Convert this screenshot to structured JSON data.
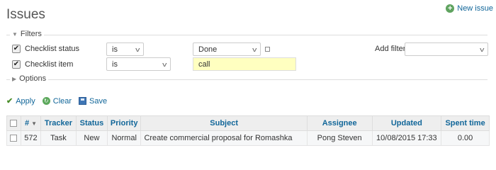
{
  "page": {
    "title": "Issues",
    "new_issue_label": "New issue"
  },
  "filters": {
    "legend": "Filters",
    "rows": [
      {
        "label": "Checklist status",
        "checked": "✔",
        "operator": "is",
        "value": "Done"
      },
      {
        "label": "Checklist item",
        "checked": "✔",
        "operator": "is",
        "value": "call"
      }
    ],
    "add_filter_label": "Add filter",
    "add_filter_value": ""
  },
  "options": {
    "legend": "Options"
  },
  "actions": {
    "apply": "Apply",
    "clear": "Clear",
    "save": "Save"
  },
  "table": {
    "headers": {
      "id": "#",
      "tracker": "Tracker",
      "status": "Status",
      "priority": "Priority",
      "subject": "Subject",
      "assignee": "Assignee",
      "updated": "Updated",
      "spent": "Spent time"
    },
    "rows": [
      {
        "id": "572",
        "tracker": "Task",
        "status": "New",
        "priority": "Normal",
        "subject": "Create commercial proposal for Romashka",
        "assignee": "Pong Steven",
        "updated": "10/08/2015 17:33",
        "spent": "0.00"
      }
    ]
  }
}
